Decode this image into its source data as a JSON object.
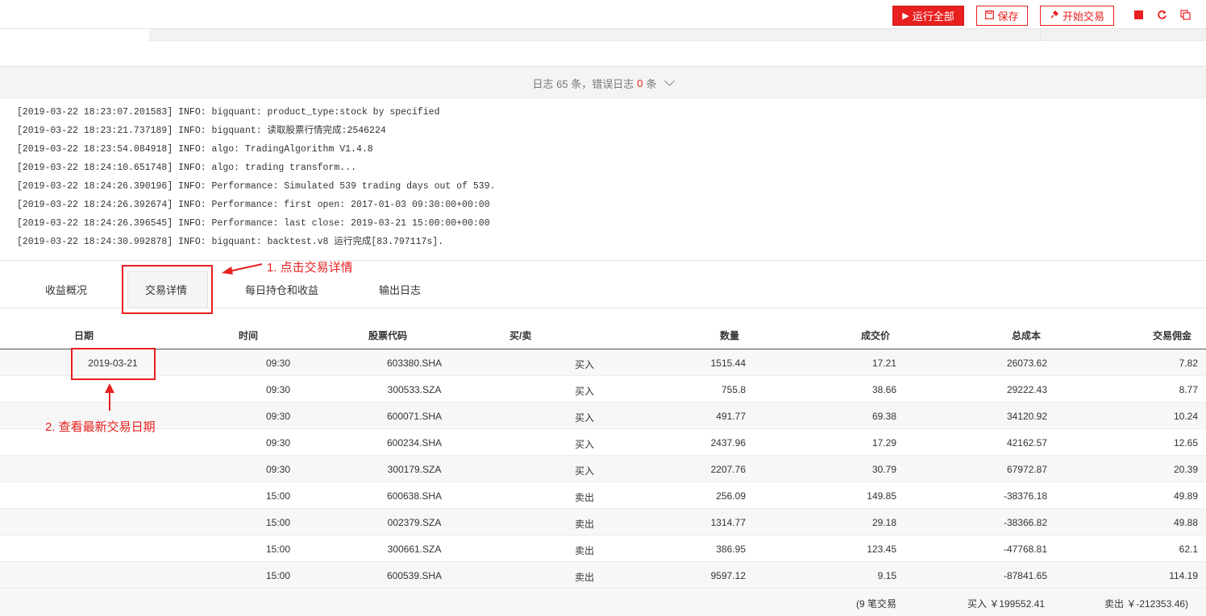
{
  "toolbar": {
    "run_all": "运行全部",
    "save": "保存",
    "start_trading": "开始交易",
    "run_icon": "▶",
    "save_icon": "💾",
    "trade_icon": "🔌"
  },
  "log_header": {
    "prefix": "日志 65 条，错误日志",
    "error_count": "0",
    "suffix": "条"
  },
  "logs": [
    "[2019-03-22 18:23:07.201583] INFO: bigquant: product_type:stock by specified",
    "[2019-03-22 18:23:21.737189] INFO: bigquant: 读取股票行情完成:2546224",
    "[2019-03-22 18:23:54.084918] INFO: algo: TradingAlgorithm V1.4.8",
    "[2019-03-22 18:24:10.651748] INFO: algo: trading transform...",
    "[2019-03-22 18:24:26.390196] INFO: Performance: Simulated 539 trading days out of 539.",
    "[2019-03-22 18:24:26.392674] INFO: Performance: first open: 2017-01-03 09:30:00+00:00",
    "[2019-03-22 18:24:26.396545] INFO: Performance: last close: 2019-03-21 15:00:00+00:00",
    "[2019-03-22 18:24:30.992878] INFO: bigquant: backtest.v8 运行完成[83.797117s]."
  ],
  "tabs": [
    "收益概况",
    "交易详情",
    "每日持仓和收益",
    "输出日志"
  ],
  "table": {
    "headers": [
      "日期",
      "时间",
      "股票代码",
      "买/卖",
      "数量",
      "成交价",
      "总成本",
      "交易佣金"
    ],
    "rows": [
      [
        "2019-03-21",
        "09:30",
        "603380.SHA",
        "买入",
        "1515.44",
        "17.21",
        "26073.62",
        "7.82"
      ],
      [
        "",
        "09:30",
        "300533.SZA",
        "买入",
        "755.8",
        "38.66",
        "29222.43",
        "8.77"
      ],
      [
        "",
        "09:30",
        "600071.SHA",
        "买入",
        "491.77",
        "69.38",
        "34120.92",
        "10.24"
      ],
      [
        "",
        "09:30",
        "600234.SHA",
        "买入",
        "2437.96",
        "17.29",
        "42162.57",
        "12.65"
      ],
      [
        "",
        "09:30",
        "300179.SZA",
        "买入",
        "2207.76",
        "30.79",
        "67972.87",
        "20.39"
      ],
      [
        "",
        "15:00",
        "600638.SHA",
        "卖出",
        "256.09",
        "149.85",
        "-38376.18",
        "49.89"
      ],
      [
        "",
        "15:00",
        "002379.SZA",
        "卖出",
        "1314.77",
        "29.18",
        "-38366.82",
        "49.88"
      ],
      [
        "",
        "15:00",
        "300661.SZA",
        "卖出",
        "386.95",
        "123.45",
        "-47768.81",
        "62.1"
      ],
      [
        "",
        "15:00",
        "600539.SHA",
        "卖出",
        "9597.12",
        "9.15",
        "-87841.65",
        "114.19"
      ]
    ],
    "summary": {
      "count": "(9 笔交易",
      "buy": "买入 ￥199552.41",
      "sell": "卖出 ￥-212353.46)"
    }
  },
  "annotations": {
    "step1": "1. 点击交易详情",
    "step2": "2. 查看最新交易日期"
  },
  "colors": {
    "accent": "#e8201f"
  }
}
